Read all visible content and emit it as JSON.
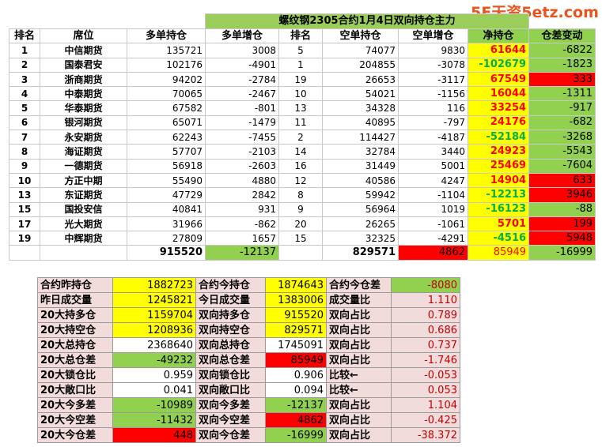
{
  "title": "螺纹钢2305合约1月4日双向持仓主力",
  "watermark": "5E天资5etz.com",
  "headers": [
    "排名",
    "席位",
    "多单持仓",
    "多单增仓",
    "排名",
    "空单持仓",
    "空单增仓",
    "净持仓",
    "仓差变动"
  ],
  "rows": [
    {
      "rank": "1",
      "seat": "中信期货",
      "long": "135721",
      "long_chg": "3008",
      "srank": "5",
      "short": "74077",
      "short_chg": "9830",
      "net": "61644",
      "diff": "-6822",
      "net_style": "y",
      "net_color": "red",
      "diff_style": "g"
    },
    {
      "rank": "2",
      "seat": "国泰君安",
      "long": "102176",
      "long_chg": "-4901",
      "srank": "1",
      "short": "204855",
      "short_chg": "-3078",
      "net": "-102679",
      "diff": "-1823",
      "net_style": "y",
      "net_color": "green",
      "diff_style": "g"
    },
    {
      "rank": "3",
      "seat": "浙商期货",
      "long": "94202",
      "long_chg": "-2784",
      "srank": "19",
      "short": "26653",
      "short_chg": "-3117",
      "net": "67549",
      "diff": "333",
      "net_style": "y",
      "net_color": "red",
      "diff_style": "red"
    },
    {
      "rank": "4",
      "seat": "中泰期货",
      "long": "70065",
      "long_chg": "-2467",
      "srank": "10",
      "short": "54021",
      "short_chg": "-1156",
      "net": "16044",
      "diff": "-1311",
      "net_style": "y",
      "net_color": "red",
      "diff_style": "g"
    },
    {
      "rank": "5",
      "seat": "华泰期货",
      "long": "67582",
      "long_chg": "-801",
      "srank": "13",
      "short": "34328",
      "short_chg": "116",
      "net": "33254",
      "diff": "-917",
      "net_style": "y",
      "net_color": "red",
      "diff_style": "g"
    },
    {
      "rank": "6",
      "seat": "银河期货",
      "long": "65071",
      "long_chg": "-1479",
      "srank": "11",
      "short": "40895",
      "short_chg": "-797",
      "net": "24176",
      "diff": "-682",
      "net_style": "y",
      "net_color": "red",
      "diff_style": "g"
    },
    {
      "rank": "7",
      "seat": "永安期货",
      "long": "62243",
      "long_chg": "-7455",
      "srank": "2",
      "short": "114427",
      "short_chg": "-4187",
      "net": "-52184",
      "diff": "-3268",
      "net_style": "y",
      "net_color": "green",
      "diff_style": "g"
    },
    {
      "rank": "8",
      "seat": "海证期货",
      "long": "57707",
      "long_chg": "-2103",
      "srank": "14",
      "short": "32784",
      "short_chg": "3440",
      "net": "24923",
      "diff": "-5543",
      "net_style": "y",
      "net_color": "red",
      "diff_style": "g"
    },
    {
      "rank": "9",
      "seat": "一德期货",
      "long": "56918",
      "long_chg": "-2603",
      "srank": "16",
      "short": "31449",
      "short_chg": "5001",
      "net": "25469",
      "diff": "-7604",
      "net_style": "y",
      "net_color": "red",
      "diff_style": "g"
    },
    {
      "rank": "10",
      "seat": "方正中期",
      "long": "55490",
      "long_chg": "4880",
      "srank": "12",
      "short": "40586",
      "short_chg": "4247",
      "net": "14904",
      "diff": "633",
      "net_style": "y",
      "net_color": "red",
      "diff_style": "red"
    },
    {
      "rank": "13",
      "seat": "东证期货",
      "long": "47729",
      "long_chg": "2842",
      "srank": "8",
      "short": "59942",
      "short_chg": "-1104",
      "net": "-12213",
      "diff": "3946",
      "net_style": "y",
      "net_color": "green",
      "diff_style": "red"
    },
    {
      "rank": "15",
      "seat": "国投安信",
      "long": "40841",
      "long_chg": "931",
      "srank": "9",
      "short": "56964",
      "short_chg": "1019",
      "net": "-16123",
      "diff": "-88",
      "net_style": "y",
      "net_color": "green",
      "diff_style": "g"
    },
    {
      "rank": "17",
      "seat": "光大期货",
      "long": "31966",
      "long_chg": "-862",
      "srank": "20",
      "short": "26265",
      "short_chg": "-1061",
      "net": "5701",
      "diff": "199",
      "net_style": "y",
      "net_color": "red",
      "diff_style": "red"
    },
    {
      "rank": "19",
      "seat": "中辉期货",
      "long": "27809",
      "long_chg": "1657",
      "srank": "15",
      "short": "32325",
      "short_chg": "-4291",
      "net": "-4516",
      "diff": "5948",
      "net_style": "y",
      "net_color": "green",
      "diff_style": "red"
    }
  ],
  "totals": {
    "long": "915520",
    "long_chg": "-12137",
    "short": "829571",
    "short_chg": "4862",
    "net": "85949",
    "diff": "-16999"
  },
  "summary": [
    {
      "l1": "合约昨持仓",
      "v1": "1882723",
      "s1": "y",
      "l2": "合约今持仓",
      "v2": "1874643",
      "s2": "y",
      "l3": "合约今仓差",
      "v3": "-8080",
      "s3": "g"
    },
    {
      "l1": "昨日成交量",
      "v1": "1245821",
      "s1": "y",
      "l2": "今日成交量",
      "v2": "1383006",
      "s2": "y",
      "l3": "成交量比",
      "v3": "1.110",
      "s3": "pink"
    },
    {
      "l1": "20大持多仓",
      "v1": "1159704",
      "s1": "y",
      "l2": "双向持多仓",
      "v2": "915520",
      "s2": "y",
      "l3": "双向占比",
      "v3": "0.789",
      "s3": "pink"
    },
    {
      "l1": "20大持空仓",
      "v1": "1208936",
      "s1": "y",
      "l2": "双向持空仓",
      "v2": "829571",
      "s2": "y",
      "l3": "双向占比",
      "v3": "0.686",
      "s3": "pink"
    },
    {
      "l1": "20大总持仓",
      "v1": "2368640",
      "s1": "w",
      "l2": "双向总持仓",
      "v2": "1745091",
      "s2": "w",
      "l3": "双向占比",
      "v3": "0.737",
      "s3": "pink"
    },
    {
      "l1": "20大总仓差",
      "v1": "-49232",
      "s1": "g",
      "l2": "双向总仓差",
      "v2": "85949",
      "s2": "red",
      "l3": "双向占比",
      "v3": "-1.746",
      "s3": "pink"
    },
    {
      "l1": "20大锁仓比",
      "v1": "0.959",
      "s1": "w",
      "l2": "双向锁仓比",
      "v2": "0.906",
      "s2": "w",
      "l3": "比较←",
      "v3": "-0.053",
      "s3": "pink"
    },
    {
      "l1": "20大敞口比",
      "v1": "0.041",
      "s1": "w",
      "l2": "双向敞口比",
      "v2": "0.094",
      "s2": "w",
      "l3": "比较←",
      "v3": "0.053",
      "s3": "pink"
    },
    {
      "l1": "20大今多差",
      "v1": "-10989",
      "s1": "g",
      "l2": "双向今多差",
      "v2": "-12137",
      "s2": "g",
      "l3": "双向占比",
      "v3": "1.104",
      "s3": "pink"
    },
    {
      "l1": "20大今空差",
      "v1": "-11432",
      "s1": "g",
      "l2": "双向今空差",
      "v2": "4862",
      "s2": "red",
      "l3": "双向占比",
      "v3": "-0.425",
      "s3": "pink"
    },
    {
      "l1": "20大今仓差",
      "v1": "448",
      "s1": "red",
      "l2": "双向今仓差",
      "v2": "-16999",
      "s2": "g",
      "l3": "双向占比",
      "v3": "-38.372",
      "s3": "pink"
    }
  ]
}
